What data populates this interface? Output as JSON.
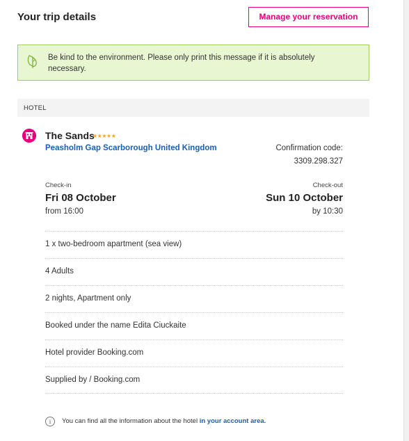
{
  "header": {
    "title": "Your trip details",
    "manage_button": "Manage your reservation"
  },
  "eco_notice": {
    "icon": "leaf-icon",
    "text": "Be kind to the environment. Please only print this message if it is absolutely necessary."
  },
  "section": {
    "label": "HOTEL"
  },
  "hotel": {
    "icon": "hotel-icon",
    "name": "The Sands",
    "stars": "★★★★★",
    "address": "Peasholm Gap Scarborough United Kingdom",
    "confirmation_label": "Confirmation code:",
    "confirmation_code": "3309.298.327"
  },
  "stay": {
    "checkin_label": "Check-in",
    "checkin_date": "Fri 08 October",
    "checkin_time": "from 16:00",
    "checkout_label": "Check-out",
    "checkout_date": "Sun 10 October",
    "checkout_time": "by 10:30"
  },
  "details": [
    "1 x two-bedroom apartment (sea view)",
    "4 Adults",
    "2 nights, Apartment only",
    "Booked under the name Edita Ciuckaite",
    "Hotel provider Booking.com",
    "Supplied by / Booking.com"
  ],
  "footer": {
    "icon": "info-icon",
    "text": "You can find all the information about the hotel",
    "link": "in your account area."
  },
  "colors": {
    "accent": "#e6007e",
    "link": "#1a5fb4",
    "eco_bg": "#e8f7d2",
    "eco_border": "#9ccf5a",
    "stars": "#f5a623"
  }
}
